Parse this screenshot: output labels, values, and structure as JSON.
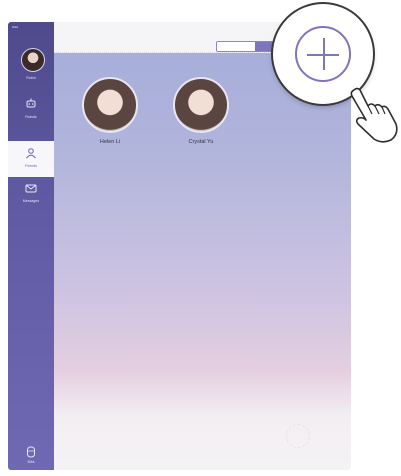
{
  "sidebar": {
    "status_text": "iPad",
    "profile_label": "Robin",
    "items": [
      {
        "label": "Robots",
        "icon": "robot-icon"
      },
      {
        "label": "Friends",
        "icon": "friends-icon"
      },
      {
        "label": "Messages",
        "icon": "messages-icon"
      }
    ],
    "bottom_label": "Bibs",
    "bottom_icon": "bibs-icon",
    "active_item": "Friends"
  },
  "topbar": {
    "segment": [
      "",
      ""
    ],
    "selected_segment_index": 1
  },
  "contacts": [
    {
      "name": "Helen Li"
    },
    {
      "name": "Crystal Yu"
    }
  ],
  "add_button": {
    "icon": "plus-icon"
  },
  "colors": {
    "accent": "#7d76bc",
    "sidebar": "#5f5aa3"
  }
}
